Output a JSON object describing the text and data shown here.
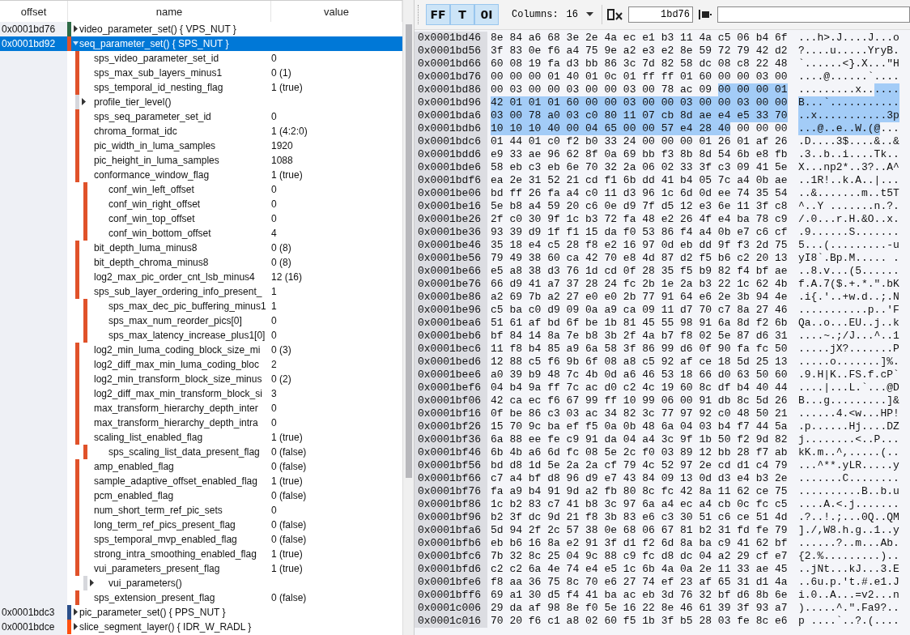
{
  "tree": {
    "columns": [
      "offset",
      "name",
      "value"
    ],
    "nodes": [
      {
        "offset": "0x0001bd76",
        "name": "video_parameter_set() { VPS_NUT }",
        "color": "#2e6b46",
        "expanded": false,
        "selected": false
      },
      {
        "offset": "0x0001bd92",
        "name": "seq_parameter_set() { SPS_NUT }",
        "color": "#e0522a",
        "expanded": true,
        "selected": true,
        "children": [
          {
            "kind": "field",
            "name": "sps_video_parameter_set_id",
            "value": "0"
          },
          {
            "kind": "field",
            "name": "sps_max_sub_layers_minus1",
            "value": "0 (1)"
          },
          {
            "kind": "field",
            "name": "sps_temporal_id_nesting_flag",
            "value": "1 (true)"
          },
          {
            "kind": "struct",
            "name": "profile_tier_level()",
            "expanded": false
          },
          {
            "kind": "field",
            "name": "sps_seq_parameter_set_id",
            "value": "0"
          },
          {
            "kind": "field",
            "name": "chroma_format_idc",
            "value": "1 (4:2:0)"
          },
          {
            "kind": "field",
            "name": "pic_width_in_luma_samples",
            "value": "1920"
          },
          {
            "kind": "field",
            "name": "pic_height_in_luma_samples",
            "value": "1088"
          },
          {
            "kind": "field",
            "name": "conformance_window_flag",
            "value": "1 (true)",
            "children": [
              {
                "kind": "field",
                "name": "conf_win_left_offset",
                "value": "0"
              },
              {
                "kind": "field",
                "name": "conf_win_right_offset",
                "value": "0"
              },
              {
                "kind": "field",
                "name": "conf_win_top_offset",
                "value": "0"
              },
              {
                "kind": "field",
                "name": "conf_win_bottom_offset",
                "value": "4"
              }
            ]
          },
          {
            "kind": "field",
            "name": "bit_depth_luma_minus8",
            "value": "0 (8)"
          },
          {
            "kind": "field",
            "name": "bit_depth_chroma_minus8",
            "value": "0 (8)"
          },
          {
            "kind": "field",
            "name": "log2_max_pic_order_cnt_lsb_minus4",
            "value": "12 (16)"
          },
          {
            "kind": "field",
            "name": "sps_sub_layer_ordering_info_present_",
            "value": "1",
            "children": [
              {
                "kind": "field",
                "name": "sps_max_dec_pic_buffering_minus1",
                "value": "1"
              },
              {
                "kind": "field",
                "name": "sps_max_num_reorder_pics[0]",
                "value": "0"
              },
              {
                "kind": "field",
                "name": "sps_max_latency_increase_plus1[0]",
                "value": "0"
              }
            ]
          },
          {
            "kind": "field",
            "name": "log2_min_luma_coding_block_size_mi",
            "value": "0 (3)"
          },
          {
            "kind": "field",
            "name": "log2_diff_max_min_luma_coding_bloc",
            "value": "2"
          },
          {
            "kind": "field",
            "name": "log2_min_transform_block_size_minus",
            "value": "0 (2)"
          },
          {
            "kind": "field",
            "name": "log2_diff_max_min_transform_block_si",
            "value": "3"
          },
          {
            "kind": "field",
            "name": "max_transform_hierarchy_depth_inter",
            "value": "0"
          },
          {
            "kind": "field",
            "name": "max_transform_hierarchy_depth_intra",
            "value": "0"
          },
          {
            "kind": "field",
            "name": "scaling_list_enabled_flag",
            "value": "1 (true)",
            "children": [
              {
                "kind": "field",
                "name": "sps_scaling_list_data_present_flag",
                "value": "0 (false)"
              }
            ]
          },
          {
            "kind": "field",
            "name": "amp_enabled_flag",
            "value": "0 (false)"
          },
          {
            "kind": "field",
            "name": "sample_adaptive_offset_enabled_flag",
            "value": "1 (true)"
          },
          {
            "kind": "field",
            "name": "pcm_enabled_flag",
            "value": "0 (false)"
          },
          {
            "kind": "field",
            "name": "num_short_term_ref_pic_sets",
            "value": "0"
          },
          {
            "kind": "field",
            "name": "long_term_ref_pics_present_flag",
            "value": "0 (false)"
          },
          {
            "kind": "field",
            "name": "sps_temporal_mvp_enabled_flag",
            "value": "0 (false)"
          },
          {
            "kind": "field",
            "name": "strong_intra_smoothing_enabled_flag",
            "value": "1 (true)"
          },
          {
            "kind": "field",
            "name": "vui_parameters_present_flag",
            "value": "1 (true)",
            "children": [
              {
                "kind": "struct",
                "name": "vui_parameters()",
                "expanded": false
              }
            ]
          },
          {
            "kind": "field",
            "name": "sps_extension_present_flag",
            "value": "0 (false)"
          }
        ]
      },
      {
        "offset": "0x0001bdc3",
        "name": "pic_parameter_set() { PPS_NUT }",
        "color": "#2b4f8a",
        "expanded": false,
        "selected": false
      },
      {
        "offset": "0x0001bdce",
        "name": "slice_segment_layer() { IDR_W_RADL }",
        "color": "#ff5010",
        "expanded": false,
        "selected": false
      }
    ]
  },
  "toolbar": {
    "toggles": [
      {
        "label": "FF",
        "on": true
      },
      {
        "label": "T",
        "on": true
      },
      {
        "label": "0I",
        "on": true
      }
    ],
    "columns_label": "Columns:",
    "columns_value": "16",
    "goto_value": "1bd76"
  },
  "hex": {
    "rows": [
      {
        "offset": "0x0001bd46",
        "segments": [
          {
            "hex": "8e 84 a6 68 3e 2e 4a ec e1 b3 11 4a c5 06 b4 6f",
            "ascii": "...h>.J....J...o",
            "selected": false
          }
        ]
      },
      {
        "offset": "0x0001bd56",
        "segments": [
          {
            "hex": "3f 83 0e f6 a4 75 9e a2 e3 e2 8e 59 72 79 42 d2",
            "ascii": "?....u.....YryB.",
            "selected": false
          }
        ]
      },
      {
        "offset": "0x0001bd66",
        "segments": [
          {
            "hex": "60 08 19 fa d3 bb 86 3c 7d 82 58 dc 08 c8 22 48",
            "ascii": "`......<}.X...\"H",
            "selected": false
          }
        ]
      },
      {
        "offset": "0x0001bd76",
        "segments": [
          {
            "hex": "00 00 00 01 40 01 0c 01 ff ff 01 60 00 00 03 00",
            "ascii": "....@......`....",
            "selected": false
          }
        ]
      },
      {
        "offset": "0x0001bd86",
        "segments": [
          {
            "hex": "00 03 00 00 03 00 00 03 00 78 ac 09",
            "ascii": ".........x..",
            "selected": false
          },
          {
            "hex": "00 00 00 01",
            "ascii": "....",
            "selected": true
          }
        ]
      },
      {
        "offset": "0x0001bd96",
        "segments": [
          {
            "hex": "42 01 01 01 60 00 00 03 00 00 03 00 00 03 00 00",
            "ascii": "B...`...........",
            "selected": true
          }
        ]
      },
      {
        "offset": "0x0001bda6",
        "segments": [
          {
            "hex": "03 00 78 a0 03 c0 80 11 07 cb 8d ae e4 e5 33 70",
            "ascii": "..x...........3p",
            "selected": true
          }
        ]
      },
      {
        "offset": "0x0001bdb6",
        "segments": [
          {
            "hex": "10 10 10 40 00 04 65 00 00 57 e4 28 40",
            "ascii": "...@..e..W.(@",
            "selected": true
          },
          {
            "hex": "00 00 00",
            "ascii": "...",
            "selected": false
          }
        ]
      },
      {
        "offset": "0x0001bdc6",
        "segments": [
          {
            "hex": "01 44 01 c0 f2 b0 33 24 00 00 00 01 26 01 af 26",
            "ascii": ".D....3$....&..&",
            "selected": false
          }
        ]
      },
      {
        "offset": "0x0001bdd6",
        "segments": [
          {
            "hex": "e9 33 ae 96 62 8f 0a 69 bb f3 8b 8d 54 6b e8 fb",
            "ascii": ".3..b..i....Tk..",
            "selected": false
          }
        ]
      },
      {
        "offset": "0x0001bde6",
        "segments": [
          {
            "hex": "58 eb c3 eb 6e 70 32 2a 06 02 33 3f c3 09 41 5e",
            "ascii": "X...np2*..3?..A^",
            "selected": false
          }
        ]
      },
      {
        "offset": "0x0001bdf6",
        "segments": [
          {
            "hex": "ea 2e 31 52 21 cd f1 6b dd 41 b4 05 7c a4 0b ae",
            "ascii": "..1R!..k.A..|...",
            "selected": false
          }
        ]
      },
      {
        "offset": "0x0001be06",
        "segments": [
          {
            "hex": "bd ff 26 fa a4 c0 11 d3 96 1c 6d 0d ee 74 35 54",
            "ascii": "..&.......m..t5T",
            "selected": false
          }
        ]
      },
      {
        "offset": "0x0001be16",
        "segments": [
          {
            "hex": "5e b8 a4 59 20 c6 0e d9 7f d5 12 e3 6e 11 3f c8",
            "ascii": "^..Y .......n.?.",
            "selected": false
          }
        ]
      },
      {
        "offset": "0x0001be26",
        "segments": [
          {
            "hex": "2f c0 30 9f 1c b3 72 fa 48 e2 26 4f e4 ba 78 c9",
            "ascii": "/.0...r.H.&O..x.",
            "selected": false
          }
        ]
      },
      {
        "offset": "0x0001be36",
        "segments": [
          {
            "hex": "93 39 d9 1f f1 15 da f0 53 86 f4 a4 0b e7 c6 cf",
            "ascii": ".9......S.......",
            "selected": false
          }
        ]
      },
      {
        "offset": "0x0001be46",
        "segments": [
          {
            "hex": "35 18 e4 c5 28 f8 e2 16 97 0d eb dd 9f f3 2d 75",
            "ascii": "5...(.........-u",
            "selected": false
          }
        ]
      },
      {
        "offset": "0x0001be56",
        "segments": [
          {
            "hex": "79 49 38 60 ca 42 70 e8 4d 87 d2 f5 b6 c2 20 13",
            "ascii": "yI8`.Bp.M..... .",
            "selected": false
          }
        ]
      },
      {
        "offset": "0x0001be66",
        "segments": [
          {
            "hex": "e5 a8 38 d3 76 1d cd 0f 28 35 f5 b9 82 f4 bf ae",
            "ascii": "..8.v...(5......",
            "selected": false
          }
        ]
      },
      {
        "offset": "0x0001be76",
        "segments": [
          {
            "hex": "66 d9 41 a7 37 28 24 fc 2b 1e 2a b3 22 1c 62 4b",
            "ascii": "f.A.7($.+.*.\".bK",
            "selected": false
          }
        ]
      },
      {
        "offset": "0x0001be86",
        "segments": [
          {
            "hex": "a2 69 7b a2 27 e0 e0 2b 77 91 64 e6 2e 3b 94 4e",
            "ascii": ".i{.'..+w.d..;.N",
            "selected": false
          }
        ]
      },
      {
        "offset": "0x0001be96",
        "segments": [
          {
            "hex": "c5 ba c0 d9 09 0a a9 ca 09 11 d7 70 c7 8a 27 46",
            "ascii": "...........p..'F",
            "selected": false
          }
        ]
      },
      {
        "offset": "0x0001bea6",
        "segments": [
          {
            "hex": "51 61 af bd 6f be 1b 81 45 55 98 91 6a 8d f2 6b",
            "ascii": "Qa..o...EU..j..k",
            "selected": false
          }
        ]
      },
      {
        "offset": "0x0001beb6",
        "segments": [
          {
            "hex": "bf 84 14 8a 7e b8 3b 2f 4a b7 f8 02 5e 87 d6 31",
            "ascii": "....~.;/J...^..1",
            "selected": false
          }
        ]
      },
      {
        "offset": "0x0001bec6",
        "segments": [
          {
            "hex": "11 f8 b4 85 a9 6a 58 3f 86 99 d6 0f 90 fa fc 50",
            "ascii": ".....jX?.......P",
            "selected": false
          }
        ]
      },
      {
        "offset": "0x0001bed6",
        "segments": [
          {
            "hex": "12 88 c5 f6 9b 6f 08 a8 c5 92 af ce 18 5d 25 13",
            "ascii": ".....o.......]%.",
            "selected": false
          }
        ]
      },
      {
        "offset": "0x0001bee6",
        "segments": [
          {
            "hex": "a0 39 b9 48 7c 4b 0d a6 46 53 18 66 d0 63 50 60",
            "ascii": ".9.H|K..FS.f.cP`",
            "selected": false
          }
        ]
      },
      {
        "offset": "0x0001bef6",
        "segments": [
          {
            "hex": "04 b4 9a ff 7c ac d0 c2 4c 19 60 8c df b4 40 44",
            "ascii": "....|...L.`...@D",
            "selected": false
          }
        ]
      },
      {
        "offset": "0x0001bf06",
        "segments": [
          {
            "hex": "42 ca ec f6 67 99 ff 10 99 06 00 91 db 8c 5d 26",
            "ascii": "B...g.........]&",
            "selected": false
          }
        ]
      },
      {
        "offset": "0x0001bf16",
        "segments": [
          {
            "hex": "0f be 86 c3 03 ac 34 82 3c 77 97 92 c0 48 50 21",
            "ascii": "......4.<w...HP!",
            "selected": false
          }
        ]
      },
      {
        "offset": "0x0001bf26",
        "segments": [
          {
            "hex": "15 70 9c ba ef f5 0a 0b 48 6a 04 03 b4 f7 44 5a",
            "ascii": ".p......Hj....DZ",
            "selected": false
          }
        ]
      },
      {
        "offset": "0x0001bf36",
        "segments": [
          {
            "hex": "6a 88 ee fe c9 91 da 04 a4 3c 9f 1b 50 f2 9d 82",
            "ascii": "j........<..P...",
            "selected": false
          }
        ]
      },
      {
        "offset": "0x0001bf46",
        "segments": [
          {
            "hex": "6b 4b a6 6d fc 08 5e 2c f0 03 89 12 bb 28 f7 ab",
            "ascii": "kK.m..^,.....(..",
            "selected": false
          }
        ]
      },
      {
        "offset": "0x0001bf56",
        "segments": [
          {
            "hex": "bd d8 1d 5e 2a 2a cf 79 4c 52 97 2e cd d1 c4 79",
            "ascii": "...^**.yLR.....y",
            "selected": false
          }
        ]
      },
      {
        "offset": "0x0001bf66",
        "segments": [
          {
            "hex": "c7 a4 bf d8 96 d9 e7 43 84 09 13 0d d3 e4 b3 2e",
            "ascii": ".......C........",
            "selected": false
          }
        ]
      },
      {
        "offset": "0x0001bf76",
        "segments": [
          {
            "hex": "fa a9 b4 91 9d a2 fb 80 8c fc 42 8a 11 62 ce 75",
            "ascii": "..........B..b.u",
            "selected": false
          }
        ]
      },
      {
        "offset": "0x0001bf86",
        "segments": [
          {
            "hex": "1c b2 83 c7 41 b8 3c 97 6a a4 ec a4 cb 0c fc c5",
            "ascii": "....A.<.j.......",
            "selected": false
          }
        ]
      },
      {
        "offset": "0x0001bf96",
        "segments": [
          {
            "hex": "b2 3f dc 9d 21 f8 3b 83 e6 c3 30 51 c6 ce 51 4d",
            "ascii": ".?..!.;...0Q..QM",
            "selected": false
          }
        ]
      },
      {
        "offset": "0x0001bfa6",
        "segments": [
          {
            "hex": "5d 94 2f 2c 57 38 0e 68 06 67 81 b2 31 fd fe 79",
            "ascii": "]./,W8.h.g..1..y",
            "selected": false
          }
        ]
      },
      {
        "offset": "0x0001bfb6",
        "segments": [
          {
            "hex": "eb b6 16 8a e2 91 3f d1 f2 6d 8a ba c9 41 62 bf",
            "ascii": "......?..m...Ab.",
            "selected": false
          }
        ]
      },
      {
        "offset": "0x0001bfc6",
        "segments": [
          {
            "hex": "7b 32 8c 25 04 9c 88 c9 fc d8 dc 04 a2 29 cf e7",
            "ascii": "{2.%.........)..",
            "selected": false
          }
        ]
      },
      {
        "offset": "0x0001bfd6",
        "segments": [
          {
            "hex": "c2 c2 6a 4e 74 e4 e5 1c 6b 4a 0a 2e 11 33 ae 45",
            "ascii": "..jNt...kJ...3.E",
            "selected": false
          }
        ]
      },
      {
        "offset": "0x0001bfe6",
        "segments": [
          {
            "hex": "f8 aa 36 75 8c 70 e6 27 74 ef 23 af 65 31 d1 4a",
            "ascii": "..6u.p.'t.#.e1.J",
            "selected": false
          }
        ]
      },
      {
        "offset": "0x0001bff6",
        "segments": [
          {
            "hex": "69 a1 30 d5 f4 41 ba ac eb 3d 76 32 bf d6 8b 6e",
            "ascii": "i.0..A...=v2...n",
            "selected": false
          }
        ]
      },
      {
        "offset": "0x0001c006",
        "segments": [
          {
            "hex": "29 da af 98 8e f0 5e 16 22 8e 46 61 39 3f 93 a7",
            "ascii": ").....^.\".Fa9?..",
            "selected": false
          }
        ]
      },
      {
        "offset": "0x0001c016",
        "segments": [
          {
            "hex": "70 20 f6 c1 a8 02 60 f5 1b 3f b5 28 03 fe 8c e6",
            "ascii": "p ....`..?.(....",
            "selected": false
          }
        ]
      }
    ]
  }
}
